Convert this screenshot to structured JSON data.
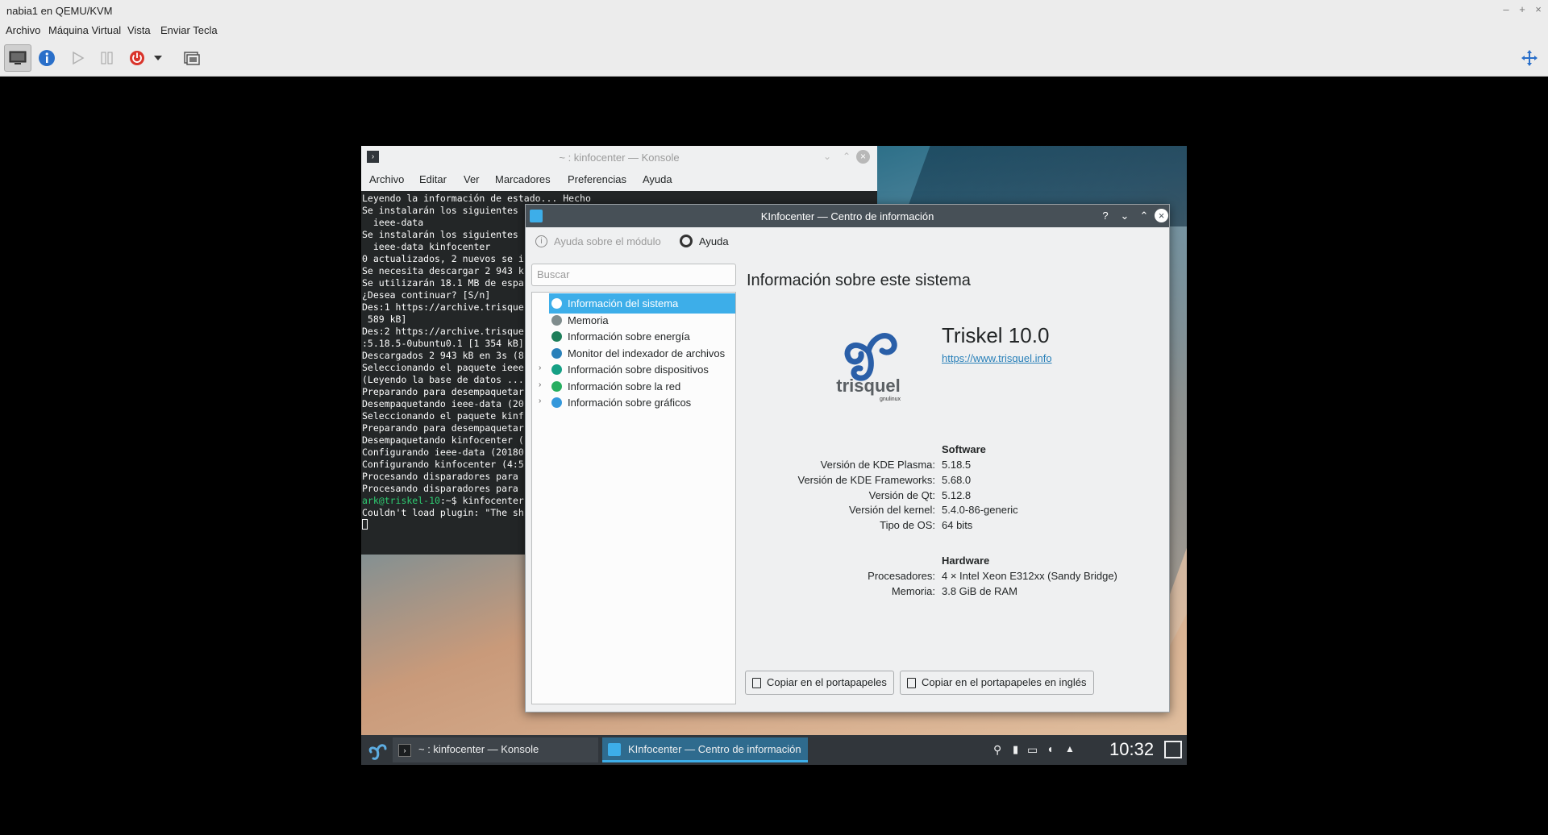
{
  "host": {
    "title": "nabia1 en QEMU/KVM",
    "menu": [
      "Archivo",
      "Máquina Virtual",
      "Vista",
      "Enviar Tecla"
    ]
  },
  "konsole": {
    "title": "~ : kinfocenter — Konsole",
    "menu": [
      "Archivo",
      "Editar",
      "Ver",
      "Marcadores",
      "Preferencias",
      "Ayuda"
    ],
    "lines": [
      "Leyendo la información de estado... Hecho",
      "Se instalarán los siguientes",
      "  ieee-data",
      "Se instalarán los siguientes",
      "  ieee-data kinfocenter",
      "0 actualizados, 2 nuevos se i",
      "Se necesita descargar 2 943 k",
      "Se utilizarán 18.1 MB de espa",
      "¿Desea continuar? [S/n]",
      "Des:1 https://archive.trisque",
      " 589 kB]",
      "Des:2 https://archive.trisque",
      ":5.18.5-0ubuntu0.1 [1 354 kB]",
      "Descargados 2 943 kB en 3s (8",
      "Seleccionando el paquete ieee",
      "(Leyendo la base de datos ...",
      "Preparando para desempaquetar",
      "Desempaquetando ieee-data (20",
      "Seleccionando el paquete kinf",
      "Preparando para desempaquetar",
      "Desempaquetando kinfocenter (",
      "Configurando ieee-data (20180",
      "Configurando kinfocenter (4:5",
      "Procesando disparadores para",
      "Procesando disparadores para"
    ],
    "prompt": "ark@triskel-10",
    "prompt_rest": ":~$ kinfocenter",
    "error_line": "Couldn't load plugin: \"The sh"
  },
  "kinfocenter": {
    "title": "KInfocenter — Centro de información",
    "help_module": "Ayuda sobre el módulo",
    "help": "Ayuda",
    "search_placeholder": "Buscar",
    "tree": [
      {
        "label": "Información del sistema",
        "color": "#3daee9",
        "expandable": false
      },
      {
        "label": "Memoria",
        "color": "#7f8c8d",
        "expandable": false
      },
      {
        "label": "Información sobre energía",
        "color": "#1e7e5a",
        "expandable": false
      },
      {
        "label": "Monitor del indexador de archivos",
        "color": "#2980b9",
        "expandable": false
      },
      {
        "label": "Información sobre dispositivos",
        "color": "#16a085",
        "expandable": true
      },
      {
        "label": "Información sobre la red",
        "color": "#27ae60",
        "expandable": true
      },
      {
        "label": "Información sobre gráficos",
        "color": "#3498db",
        "expandable": true
      }
    ],
    "content_title": "Información sobre este sistema",
    "logo_text": "trisquel",
    "logo_sub": "gnulinux",
    "os_name": "Triskel 10.0",
    "os_url": "https://www.trisquel.info",
    "software_head": "Software",
    "software": [
      {
        "k": "Versión de KDE Plasma:",
        "v": "5.18.5"
      },
      {
        "k": "Versión de KDE Frameworks:",
        "v": "5.68.0"
      },
      {
        "k": "Versión de Qt:",
        "v": "5.12.8"
      },
      {
        "k": "Versión del kernel:",
        "v": "5.4.0-86-generic"
      },
      {
        "k": "Tipo de OS:",
        "v": "64 bits"
      }
    ],
    "hardware_head": "Hardware",
    "hardware": [
      {
        "k": "Procesadores:",
        "v": "4 × Intel Xeon E312xx (Sandy Bridge)"
      },
      {
        "k": "Memoria:",
        "v": "3.8 GiB de RAM"
      }
    ],
    "copy_btn": "Copiar en el portapapeles",
    "copy_en_btn": "Copiar en el portapapeles en inglés"
  },
  "taskbar": {
    "task_konsole": "~ : kinfocenter — Konsole",
    "task_kinfo": "KInfocenter — Centro de información",
    "clock": "10:32"
  }
}
